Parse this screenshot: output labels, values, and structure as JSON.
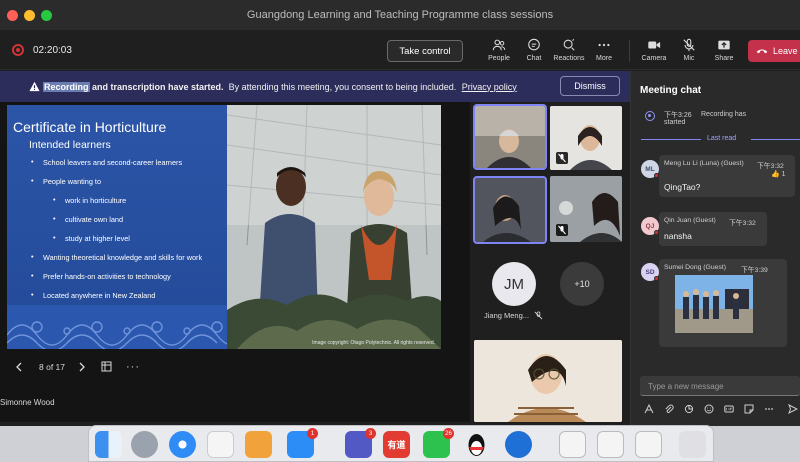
{
  "window": {
    "title": "Guangdong Learning and Teaching Programme class sessions"
  },
  "toolbar": {
    "timer": "02:20:03",
    "take_control": "Take control",
    "people": "People",
    "chat": "Chat",
    "reactions": "Reactions",
    "more": "More",
    "camera": "Camera",
    "mic": "Mic",
    "share": "Share",
    "leave": "Leave"
  },
  "banner": {
    "word_highlight": "Recording",
    "bold_rest": " and transcription have started.",
    "text": "By attending this meeting, you consent to being included.",
    "link": "Privacy policy",
    "dismiss": "Dismiss"
  },
  "slide": {
    "title": "Certificate in Horticulture",
    "subtitle": "Intended learners",
    "bullets": [
      "School leavers and second-career learners",
      "People wanting to",
      "work in horticulture",
      "cultivate own land",
      "study at higher level",
      "Wanting theoretical knowledge and skills for work",
      "Prefer hands-on activities to technology",
      "Located anywhere in New Zealand"
    ],
    "copyright": "Image copyright: Otago Polytechnic. All rights reserved.",
    "pager": "8 of 17",
    "presenter": "Simonne Wood"
  },
  "participants": {
    "jm_initials": "JM",
    "jm_name": "Jiang Meng...",
    "more_count": "+10"
  },
  "chat": {
    "title": "Meeting chat",
    "system_time": "下午3:26",
    "system_text_1": "Recording has",
    "system_text_2": "started",
    "last_read": "Last read",
    "messages": [
      {
        "initials": "ML",
        "sender": "Meng Lu Li (Luna) (Guest)",
        "time": "下午3:32",
        "text": "QingTao?",
        "reaction": "1"
      },
      {
        "initials": "QJ",
        "sender": "Qin Juan (Guest)",
        "time": "下午3:32",
        "text": "nansha"
      },
      {
        "initials": "SD",
        "sender": "Sumei Dong (Guest)",
        "time": "下午3:39"
      }
    ],
    "compose_placeholder": "Type a new message"
  },
  "dock": {
    "appstore_badge": "1",
    "teams_badge": "3",
    "youdao_label": "有道",
    "wechat_badge": "26"
  },
  "colors": {
    "accent": "#7f85f5",
    "leave": "#c4314b",
    "banner": "#2d2d5c",
    "slide_blue": "#2a4e9b"
  }
}
